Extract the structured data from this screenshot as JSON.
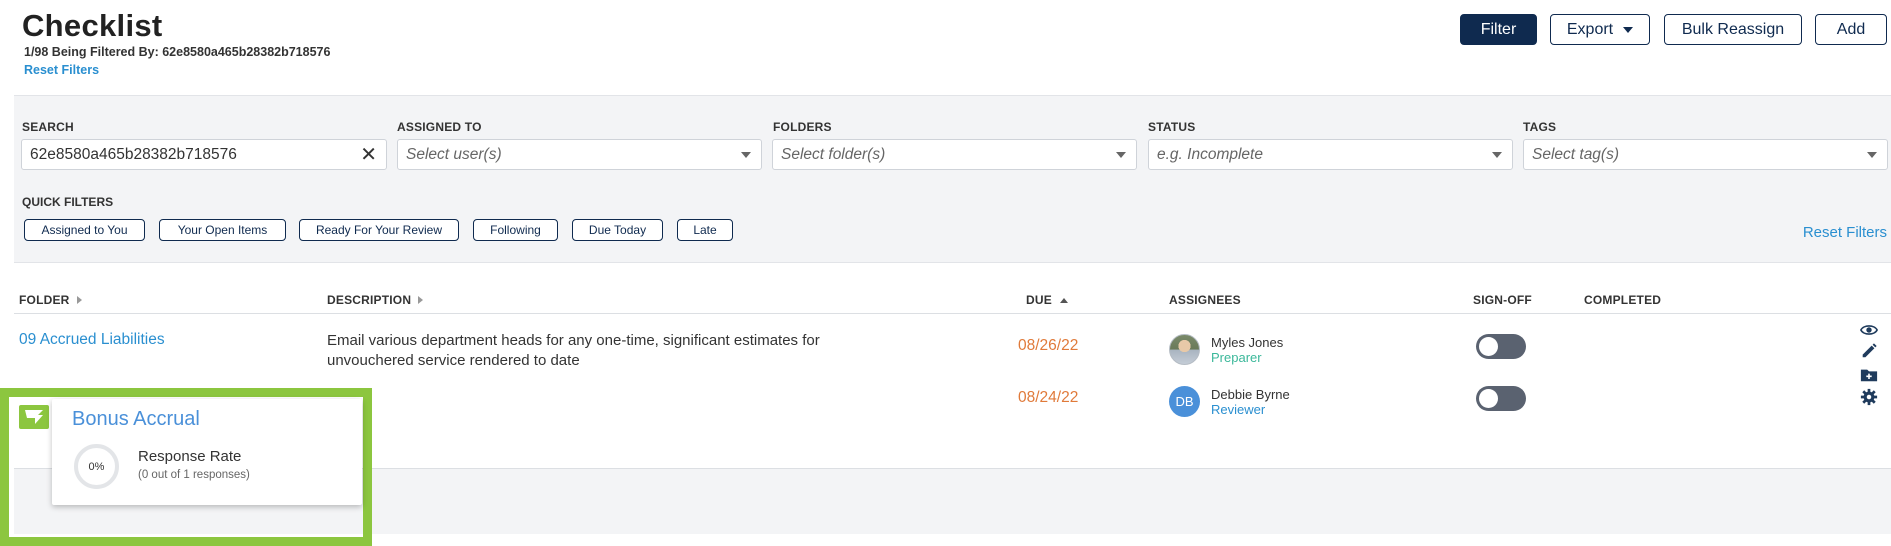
{
  "header": {
    "title": "Checklist",
    "filter_status": "1/98 Being Filtered By: 62e8580a465b28382b718576",
    "reset_filters": "Reset Filters",
    "buttons": {
      "filter": "Filter",
      "export": "Export",
      "bulk_reassign": "Bulk Reassign",
      "add": "Add"
    }
  },
  "filters": {
    "search": {
      "label": "SEARCH",
      "value": "62e8580a465b28382b718576"
    },
    "assigned_to": {
      "label": "ASSIGNED TO",
      "placeholder": "Select user(s)"
    },
    "folders": {
      "label": "FOLDERS",
      "placeholder": "Select folder(s)"
    },
    "status": {
      "label": "STATUS",
      "placeholder": "e.g. Incomplete"
    },
    "tags": {
      "label": "TAGS",
      "placeholder": "Select tag(s)"
    },
    "quick_filters_label": "QUICK FILTERS",
    "quick_filters": [
      "Assigned to You",
      "Your Open Items",
      "Ready For Your Review",
      "Following",
      "Due Today",
      "Late"
    ],
    "reset_filters": "Reset Filters"
  },
  "table": {
    "columns": {
      "folder": "FOLDER",
      "description": "DESCRIPTION",
      "due": "DUE",
      "assignees": "ASSIGNEES",
      "signoff": "SIGN-OFF",
      "completed": "COMPLETED"
    },
    "row": {
      "folder": "09 Accrued Liabilities",
      "description": "Email various department heads for any one-time, significant estimates for unvouchered service rendered to date",
      "assignees": [
        {
          "name": "Myles Jones",
          "role": "Preparer",
          "due": "08/26/22",
          "signed_off": false
        },
        {
          "name": "Debbie Byrne",
          "role": "Reviewer",
          "initials": "DB",
          "due": "08/24/22",
          "signed_off": false
        }
      ],
      "actions": [
        "eye-icon",
        "pencil-icon",
        "folder-plus-icon",
        "gear-icon"
      ]
    }
  },
  "popup": {
    "title": "Bonus Accrual",
    "percent": "0%",
    "label": "Response Rate",
    "sub": "(0 out of 1 responses)"
  },
  "colors": {
    "primary_navy": "#0f2a4f",
    "link_blue": "#2a8fd0",
    "due_orange": "#e07a3a",
    "preparer_teal": "#3bb89a",
    "overlay_green": "#8cc63f"
  }
}
